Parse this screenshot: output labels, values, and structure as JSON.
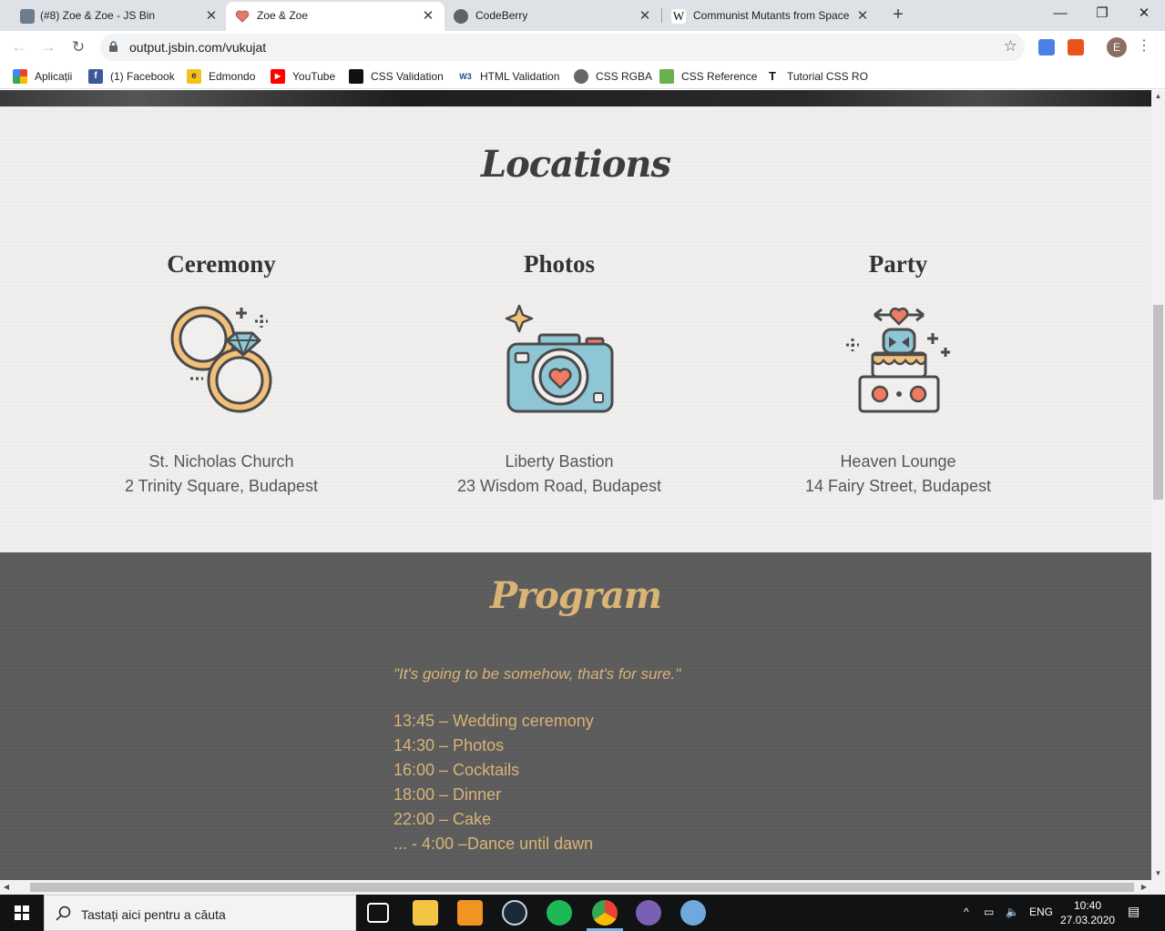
{
  "browser": {
    "tabs": [
      {
        "title": "(#8) Zoe & Zoe - JS Bin",
        "active": false
      },
      {
        "title": "Zoe & Zoe",
        "active": true
      },
      {
        "title": "CodeBerry",
        "active": false
      },
      {
        "title": "Communist Mutants from Space",
        "active": false
      }
    ],
    "new_tab": "+",
    "window_controls": {
      "minimize": "—",
      "restore": "❐",
      "close": "✕"
    },
    "url": "output.jsbin.com/vukujat",
    "profile_initial": "E",
    "bookmarks": [
      "Aplicații",
      "(1) Facebook",
      "Edmondo",
      "YouTube",
      "CSS Validation",
      "HTML Validation",
      "CSS RGBA",
      "CSS Reference",
      "Tutorial CSS RO"
    ]
  },
  "page": {
    "locations_title": "Locations",
    "locations": [
      {
        "heading": "Ceremony",
        "icon": "wedding-rings-icon",
        "name": "St. Nicholas Church",
        "address": "2 Trinity Square, Budapest"
      },
      {
        "heading": "Photos",
        "icon": "camera-icon",
        "name": "Liberty Bastion",
        "address": "23 Wisdom Road, Budapest"
      },
      {
        "heading": "Party",
        "icon": "wedding-cake-icon",
        "name": "Heaven Lounge",
        "address": "14 Fairy Street, Budapest"
      }
    ],
    "program_title": "Program",
    "program_quote": "\"It's going to be somehow, that's for sure.\"",
    "schedule": [
      "13:45 – Wedding ceremony",
      "14:30 – Photos",
      "16:00 – Cocktails",
      "18:00 – Dinner",
      "22:00 – Cake",
      "... - 4:00 –Dance until dawn"
    ],
    "colors": {
      "accent_gold": "#d8b476",
      "program_bg": "#5c5b5b",
      "icon_blue": "#8ec6d6",
      "icon_coral": "#f07b63"
    }
  },
  "taskbar": {
    "search_placeholder": "Tastați aici pentru a căuta",
    "language": "ENG",
    "time": "10:40",
    "date": "27.03.2020"
  }
}
